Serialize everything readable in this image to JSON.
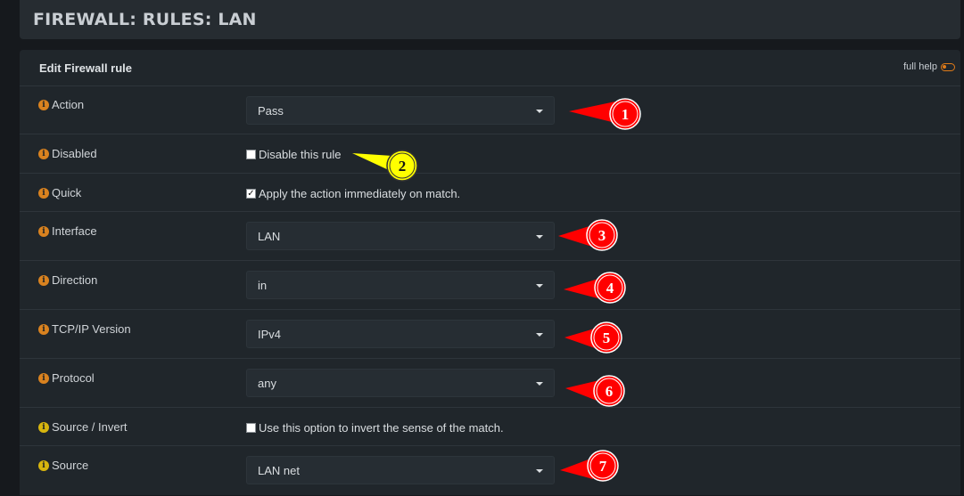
{
  "header": {
    "title": "FIREWALL: RULES: LAN"
  },
  "panel": {
    "title": "Edit Firewall rule",
    "full_help": "full help"
  },
  "rows": {
    "action": {
      "label": "Action",
      "value": "Pass"
    },
    "disabled": {
      "label": "Disabled",
      "checkbox_label": "Disable this rule",
      "checked": false
    },
    "quick": {
      "label": "Quick",
      "checkbox_label": "Apply the action immediately on match.",
      "checked": true
    },
    "interface": {
      "label": "Interface",
      "value": "LAN"
    },
    "direction": {
      "label": "Direction",
      "value": "in"
    },
    "tcpip": {
      "label": "TCP/IP Version",
      "value": "IPv4"
    },
    "protocol": {
      "label": "Protocol",
      "value": "any"
    },
    "src_invert": {
      "label": "Source / Invert",
      "checkbox_label": "Use this option to invert the sense of the match.",
      "checked": false
    },
    "source": {
      "label": "Source",
      "value": "LAN net"
    }
  },
  "markers": [
    "1",
    "2",
    "3",
    "4",
    "5",
    "6",
    "7"
  ],
  "icons": {
    "info": "info-icon",
    "caret": "chevron-down-icon",
    "toggle": "toggle-icon",
    "check": "checkmark-icon"
  },
  "colors": {
    "accent": "#e07b18",
    "marker_red": "#ff0000",
    "marker_yellow": "#ffff00"
  }
}
